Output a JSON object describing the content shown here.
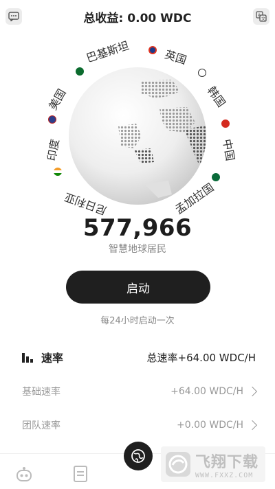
{
  "header": {
    "title_prefix": "总收益:",
    "title_value": "0.00 WDC"
  },
  "globe": {
    "countries": [
      "巴基斯坦",
      "英国",
      "韩国",
      "中国",
      "孟加拉国",
      "尼日利亚",
      "印度",
      "美国"
    ]
  },
  "stats": {
    "population": "577,966",
    "population_label": "智慧地球居民"
  },
  "actions": {
    "start_label": "启动",
    "start_hint": "每24小时启动一次"
  },
  "rate": {
    "heading": "速率",
    "total": "总速率+64.00 WDC/H",
    "rows": [
      {
        "label": "基础速率",
        "value": "+64.00 WDC/H"
      },
      {
        "label": "团队速率",
        "value": "+0.00 WDC/H"
      }
    ]
  },
  "watermark": {
    "title": "飞翔下载",
    "url": "WWW.FXXZ.COM"
  },
  "colors": {
    "primary": "#1f1f1f",
    "muted": "#888888"
  }
}
